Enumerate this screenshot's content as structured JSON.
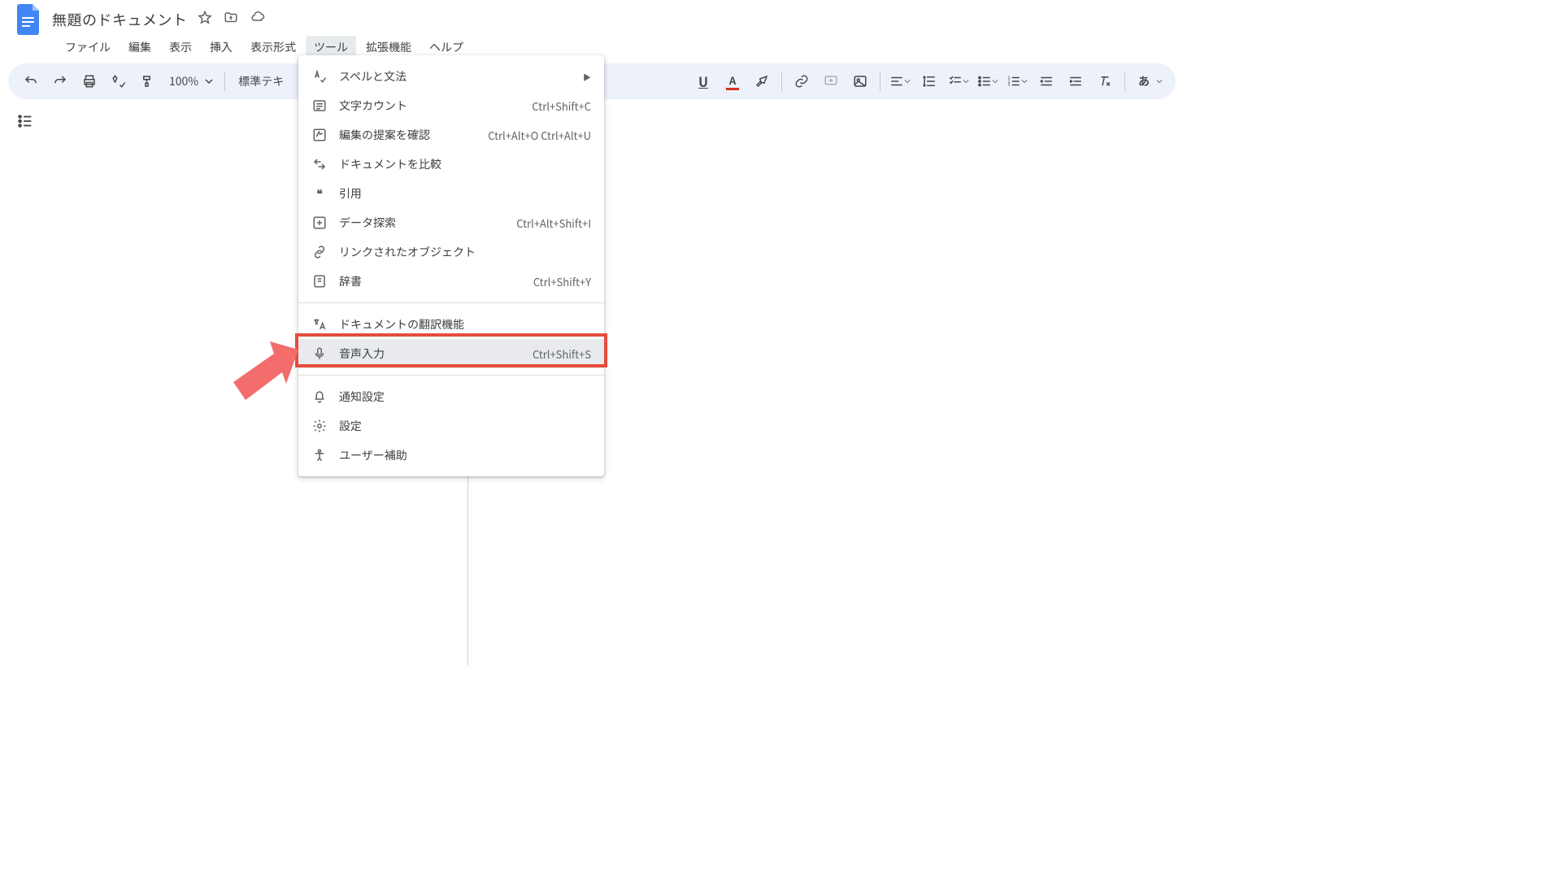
{
  "doc": {
    "title": "無題のドキュメント"
  },
  "menus": {
    "file": "ファイル",
    "edit": "編集",
    "view": "表示",
    "insert": "挿入",
    "format": "表示形式",
    "tools": "ツール",
    "extensions": "拡張機能",
    "help": "ヘルプ"
  },
  "toolbar": {
    "zoom": "100%",
    "style": "標準テキ",
    "ime": "あ"
  },
  "tools_menu": {
    "spelling": {
      "label": "スペルと文法"
    },
    "word_count": {
      "label": "文字カウント",
      "shortcut": "Ctrl+Shift+C"
    },
    "review_suggestions": {
      "label": "編集の提案を確認",
      "shortcut": "Ctrl+Alt+O Ctrl+Alt+U"
    },
    "compare": {
      "label": "ドキュメントを比較"
    },
    "citations": {
      "label": "引用"
    },
    "explore": {
      "label": "データ探索",
      "shortcut": "Ctrl+Alt+Shift+I"
    },
    "linked_objects": {
      "label": "リンクされたオブジェクト"
    },
    "dictionary": {
      "label": "辞書",
      "shortcut": "Ctrl+Shift+Y"
    },
    "translate": {
      "label": "ドキュメントの翻訳機能"
    },
    "voice": {
      "label": "音声入力",
      "shortcut": "Ctrl+Shift+S"
    },
    "notifications": {
      "label": "通知設定"
    },
    "preferences": {
      "label": "設定"
    },
    "accessibility": {
      "label": "ユーザー補助"
    }
  }
}
